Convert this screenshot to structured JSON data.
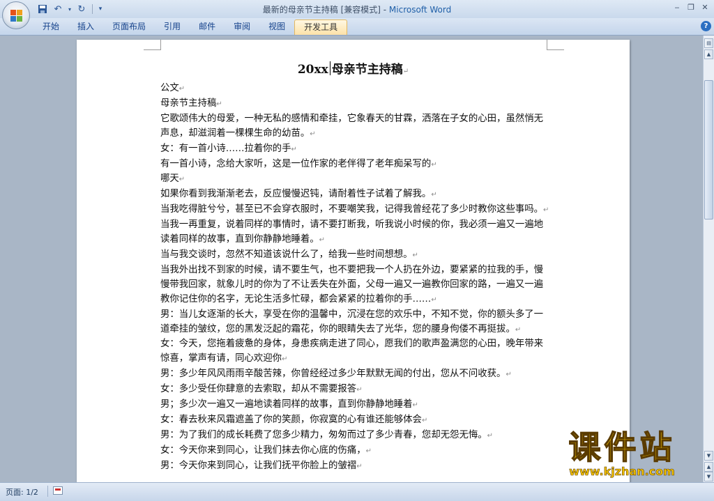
{
  "window": {
    "title": "最新的母亲节主持稿 [兼容模式] - ",
    "app_name": "Microsoft Word"
  },
  "ribbon": {
    "tabs": [
      {
        "label": "开始"
      },
      {
        "label": "插入"
      },
      {
        "label": "页面布局"
      },
      {
        "label": "引用"
      },
      {
        "label": "邮件"
      },
      {
        "label": "审阅"
      },
      {
        "label": "视图"
      },
      {
        "label": "开发工具",
        "active": true
      }
    ]
  },
  "document": {
    "title_part1": "20xx",
    "title_part2": "母亲节主持稿",
    "paragraphs": [
      "公文",
      "母亲节主持稿",
      "它歌颂伟大的母爱，一种无私的感情和牵挂，它象春天的甘霖，洒落在子女的心田，虽然悄无声息，却滋润着一棵棵生命的幼苗。",
      "女：有一首小诗……拉着你的手",
      "有一首小诗，念给大家听，这是一位作家的老伴得了老年痴呆写的",
      "哪天",
      "如果你看到我渐渐老去，反应慢慢迟钝，请耐着性子试着了解我。",
      "当我吃得脏兮兮，甚至已不会穿衣服时，不要嘲笑我，记得我曾经花了多少时教你这些事吗。",
      "当我一再重复，说着同样的事情时，请不要打断我，听我说小时候的你，我必须一遍又一遍地读着同样的故事，直到你静静地睡着。",
      "当与我交谈时，忽然不知道该说什么了，给我一些时间想想。",
      "当我外出找不到家的时候，请不要生气，也不要把我一个人扔在外边，要紧紧的拉我的手，慢慢带我回家，就象儿时的你为了不让丢失在外面，父母一遍又一遍教你回家的路，一遍又一遍教你记住你的名字，无论生活多忙碌，都会紧紧的拉着你的手……",
      "男：当儿女逐渐的长大，享受在你的温馨中，沉浸在您的欢乐中，不知不觉，你的额头多了一道牵挂的皱纹，您的黑发泛起的霜花，你的眼睛失去了光华，您的腰身佝偻不再挺拔。",
      "女：今天，您拖着疲惫的身体，身患疾病走进了同心，愿我们的歌声盈满您的心田，晚年带来惊喜，掌声有请，同心欢迎你",
      "男：多少年风风雨雨辛酸苦辣，你曾经经过多少年默默无闻的付出，您从不问收获。",
      "女：多少受任你肆意的去索取，却从不需要报答",
      "男；多少次一遍又一遍地读着同样的故事，直到你静静地睡着",
      "女：春去秋来风霜遮盖了你的笑颜，你寂寞的心有谁还能够体会",
      "男：为了我们的成长耗费了您多少精力，匆匆而过了多少青春，您却无怨无悔。",
      "女：今天你来到同心，让我们抹去你心底的伤痛，",
      "男：今天你来到同心，让我们抚平你脸上的皱褶"
    ]
  },
  "status": {
    "page_info": "页面: 1/2"
  },
  "watermark": {
    "big": "课件站",
    "url": "www.kjzhan.com"
  }
}
